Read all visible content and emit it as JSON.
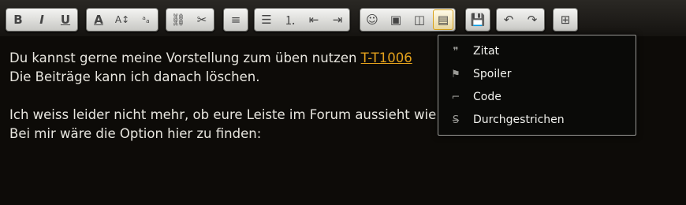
{
  "toolbar": {
    "groups": [
      {
        "buttons": [
          {
            "name": "bold-button",
            "glyph": "B"
          },
          {
            "name": "italic-button",
            "glyph": "I"
          },
          {
            "name": "underline-button",
            "glyph": "U"
          }
        ]
      },
      {
        "buttons": [
          {
            "name": "font-color-button",
            "glyph": "A"
          },
          {
            "name": "font-size-button",
            "glyph": "A↕"
          },
          {
            "name": "superscript-subscript-button",
            "glyph": "ᵃₐ"
          }
        ]
      },
      {
        "buttons": [
          {
            "name": "link-button",
            "glyph": "⛓"
          },
          {
            "name": "unlink-button",
            "glyph": "✂"
          }
        ]
      },
      {
        "buttons": [
          {
            "name": "align-button",
            "glyph": "≡"
          }
        ]
      },
      {
        "buttons": [
          {
            "name": "bullet-list-button",
            "glyph": "☰"
          },
          {
            "name": "numbered-list-button",
            "glyph": "⒈"
          },
          {
            "name": "outdent-button",
            "glyph": "⇤"
          },
          {
            "name": "indent-button",
            "glyph": "⇥"
          }
        ]
      },
      {
        "buttons": [
          {
            "name": "smiley-button",
            "glyph": "☺"
          },
          {
            "name": "image-button",
            "glyph": "▣"
          },
          {
            "name": "media-button",
            "glyph": "◫"
          },
          {
            "name": "format-dropdown-button",
            "glyph": "▤",
            "selected": true
          }
        ]
      },
      {
        "buttons": [
          {
            "name": "save-button",
            "glyph": "💾"
          }
        ]
      },
      {
        "buttons": [
          {
            "name": "undo-button",
            "glyph": "↶"
          },
          {
            "name": "redo-button",
            "glyph": "↷"
          }
        ]
      },
      {
        "buttons": [
          {
            "name": "table-button",
            "glyph": "⊞"
          }
        ]
      }
    ]
  },
  "content": {
    "line1_text": "Du kannst gerne meine Vorstellung zum üben nutzen ",
    "line1_link": "T-T1006",
    "line2": "Die Beiträge kann ich danach löschen.",
    "line3": "Ich weiss leider nicht mehr, ob eure Leiste im Forum aussieht wie meine,",
    "line4": "Bei mir wäre die Option hier zu finden:"
  },
  "menu": {
    "items": [
      {
        "name": "menu-item-zitat",
        "icon": "quote-icon",
        "glyph": "❞",
        "label": "Zitat"
      },
      {
        "name": "menu-item-spoiler",
        "icon": "flag-icon",
        "glyph": "⚑",
        "label": "Spoiler"
      },
      {
        "name": "menu-item-code",
        "icon": "code-icon",
        "glyph": "⌐",
        "label": "Code"
      },
      {
        "name": "menu-item-durchgestrichen",
        "icon": "strikethrough-icon",
        "glyph": "S̶",
        "label": "Durchgestrichen"
      }
    ]
  },
  "colors": {
    "link": "#e4a21c",
    "background": "#0d0b08",
    "text": "#e8e6df"
  }
}
